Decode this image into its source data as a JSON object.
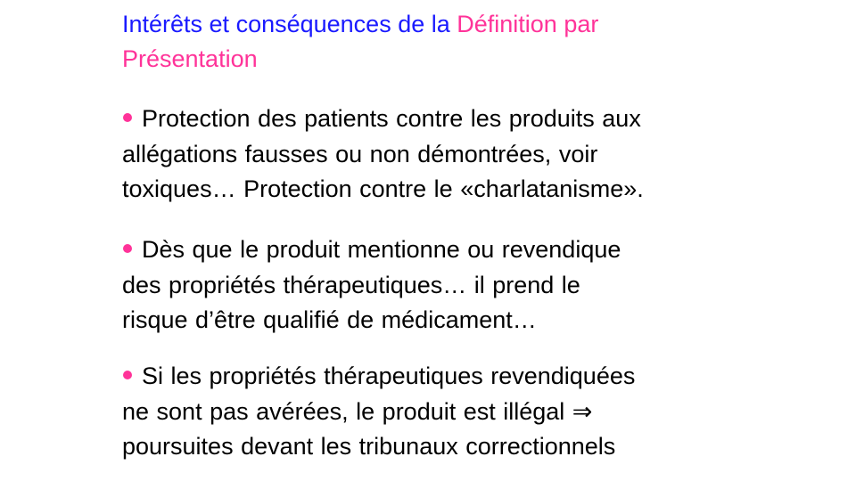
{
  "title": {
    "part1": "Intérêts et conséquences de la ",
    "part2a": "Définition par",
    "part2b": "Présentation"
  },
  "bullets": [
    {
      "lines": [
        "Protection des patients contre les produits aux",
        "allégations  fausses ou non démontrées, voir",
        "toxiques…  Protection contre le «charlatanisme»."
      ]
    },
    {
      "lines": [
        "Dès que le produit mentionne ou revendique",
        "des propriétés  thérapeutiques…  il prend le",
        "risque d’être qualifié de médicament…"
      ]
    },
    {
      "lines": [
        "Si les propriétés thérapeutiques revendiquées",
        "ne sont pas avérées, le produit est illégal ⇒",
        "poursuites devant  les tribunaux correctionnels"
      ]
    }
  ],
  "colors": {
    "title_blue": "#1a1aff",
    "title_pink": "#ff3399",
    "bullet_dot": "#ff3399",
    "text": "#000000"
  }
}
